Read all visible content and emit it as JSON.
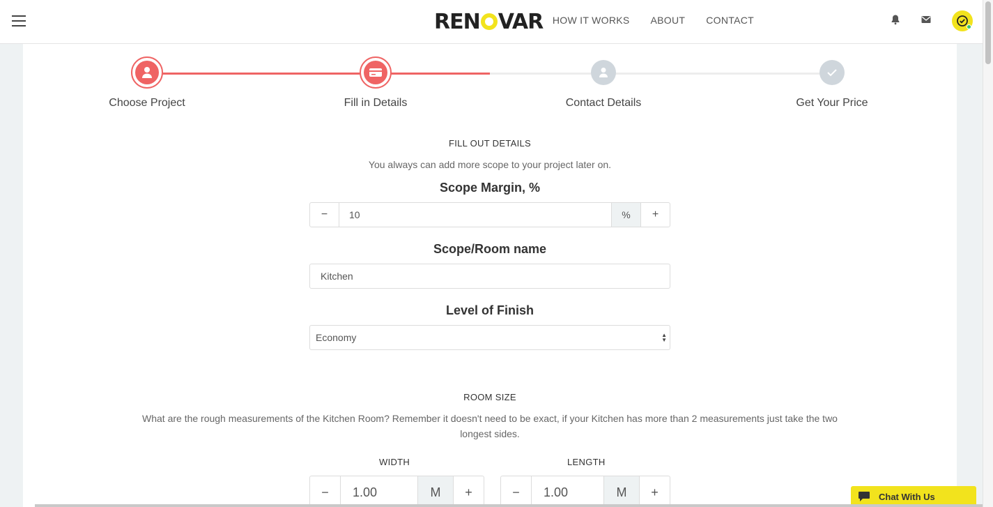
{
  "header": {
    "brand_left": "REN",
    "brand_right": "VAR",
    "nav": [
      "HOW IT WORKS",
      "ABOUT",
      "CONTACT"
    ]
  },
  "steps": [
    {
      "label": "Choose Project",
      "status": "done",
      "icon": "person-icon"
    },
    {
      "label": "Fill in Details",
      "status": "current",
      "icon": "card-icon"
    },
    {
      "label": "Contact Details",
      "status": "pending",
      "icon": "person-icon"
    },
    {
      "label": "Get Your Price",
      "status": "pending",
      "icon": "check-icon"
    }
  ],
  "details": {
    "title": "FILL OUT DETAILS",
    "subtitle": "You always can add more scope to your project later on.",
    "scope_margin": {
      "label": "Scope Margin, %",
      "value": "10",
      "unit": "%",
      "minus": "−",
      "plus": "+"
    },
    "room_name": {
      "label": "Scope/Room name",
      "value": "Kitchen"
    },
    "finish": {
      "label": "Level of Finish",
      "value": "Economy"
    }
  },
  "room_size": {
    "title": "ROOM SIZE",
    "description": "What are the rough measurements of the Kitchen Room? Remember it doesn't need to be exact, if your Kitchen has more than 2 measurements just take the two longest sides.",
    "width": {
      "label": "WIDTH",
      "value": "1.00",
      "unit": "M",
      "minus": "−",
      "plus": "+"
    },
    "length": {
      "label": "LENGTH",
      "value": "1.00",
      "unit": "M",
      "minus": "−",
      "plus": "+"
    }
  },
  "chat": {
    "label": "Chat With Us"
  },
  "colors": {
    "accent": "#ef6464",
    "brand_yellow": "#f2e31d",
    "pending": "#cfd6dc"
  }
}
